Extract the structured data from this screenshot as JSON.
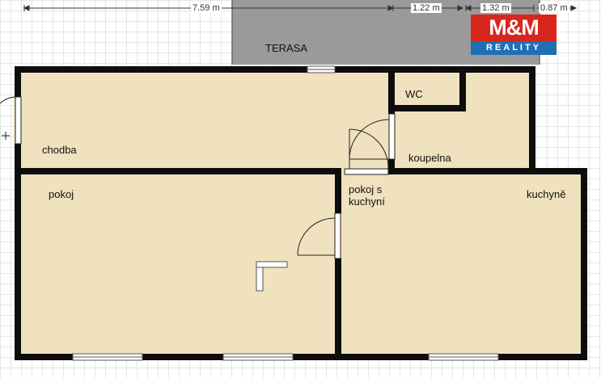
{
  "dimensions": {
    "total": "7.59 m",
    "seg1": "1.22 m",
    "seg2": "1.32 m",
    "seg3": "0.87 m"
  },
  "rooms": {
    "terasa": "TERASA",
    "wc": "WC",
    "chodba": "chodba",
    "koupelna": "koupelna",
    "pokoj": "pokoj",
    "pokoj_s_kuchyni_line1": "pokoj s",
    "pokoj_s_kuchyni_line2": "kuchyní",
    "kuchyne": "kuchyně"
  },
  "logo": {
    "top": "M&M",
    "bottom": "REALITY",
    "red": "#d7261e",
    "blue": "#1f6fb5"
  },
  "colors": {
    "floor": "#f0e1bf",
    "wall": "#0d0d0d",
    "terrace": "#9a9a9a"
  }
}
